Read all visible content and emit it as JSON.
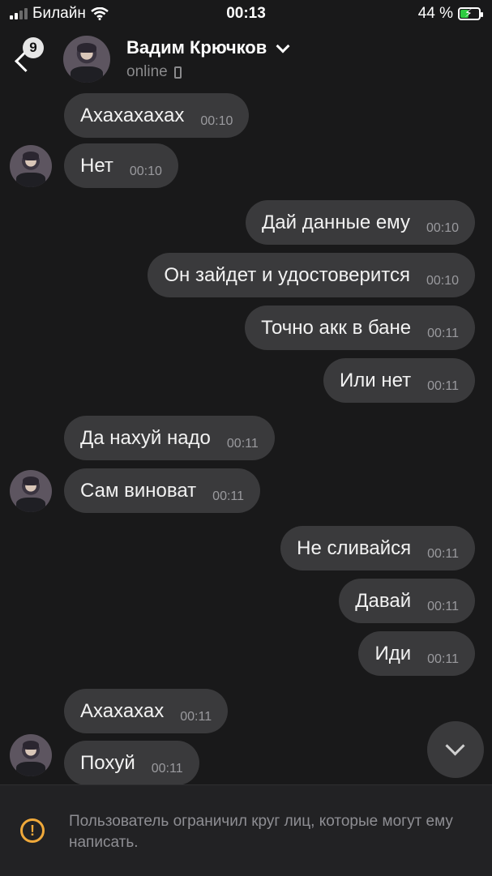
{
  "status_bar": {
    "carrier": "Билайн",
    "time": "00:13",
    "battery_percent": "44 %",
    "battery_level": 0.44
  },
  "header": {
    "back_badge": "9",
    "contact_name": "Вадим Крючков",
    "presence": "online"
  },
  "messages": [
    {
      "direction": "in",
      "text": "Ахахахахах",
      "time": "00:10"
    },
    {
      "direction": "in",
      "text": "Нет",
      "time": "00:10"
    },
    {
      "direction": "out",
      "text": "Дай данные ему",
      "time": "00:10"
    },
    {
      "direction": "out",
      "text": "Он зайдет и удостоверится",
      "time": "00:10"
    },
    {
      "direction": "out",
      "text": "Точно акк в бане",
      "time": "00:11"
    },
    {
      "direction": "out",
      "text": "Или нет",
      "time": "00:11"
    },
    {
      "direction": "in",
      "text": "Да нахуй надо",
      "time": "00:11"
    },
    {
      "direction": "in",
      "text": "Сам виноват",
      "time": "00:11"
    },
    {
      "direction": "out",
      "text": "Не сливайся",
      "time": "00:11"
    },
    {
      "direction": "out",
      "text": "Давай",
      "time": "00:11"
    },
    {
      "direction": "out",
      "text": "Иди",
      "time": "00:11"
    },
    {
      "direction": "in",
      "text": "Ахахахах",
      "time": "00:11"
    },
    {
      "direction": "in",
      "text": "Похуй",
      "time": "00:11"
    }
  ],
  "notice": {
    "text": "Пользователь ограничил круг лиц, которые могут ему написать."
  },
  "icons": {
    "back": "chevron-left-icon",
    "dropdown": "chevron-down-icon",
    "device": "mobile-phone-icon",
    "scroll_down": "chevron-down-icon",
    "warning": "exclamation-circle-icon"
  },
  "colors": {
    "background": "#19191a",
    "bubble": "#3a3a3c",
    "warning": "#f0a93a",
    "battery": "#2ecc40"
  }
}
